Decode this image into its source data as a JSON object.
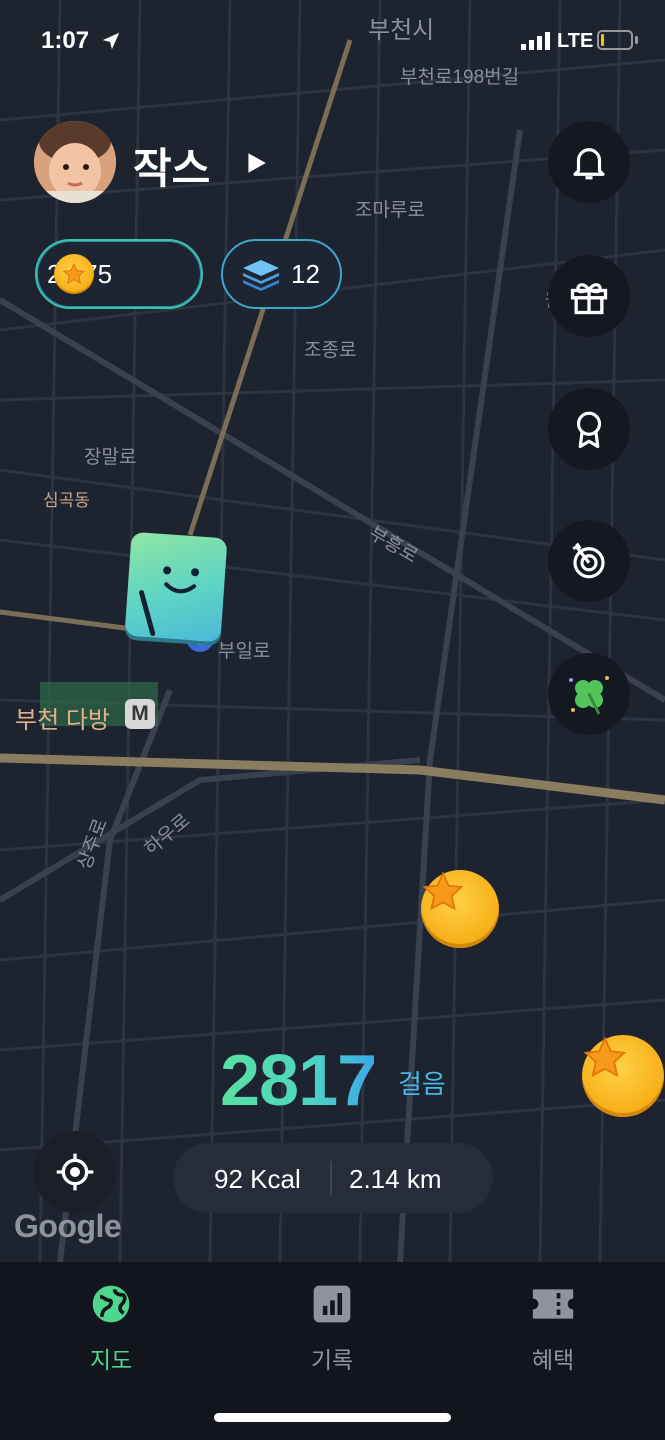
{
  "status_bar": {
    "time": "1:07",
    "network": "LTE"
  },
  "profile": {
    "name": "작스"
  },
  "wallet": {
    "coins": "2,375",
    "layers": "12"
  },
  "map": {
    "labels": {
      "bucheon_si": "부천시",
      "bucheonro": "부천로198번길",
      "jomaruro": "조마루로",
      "jongro": "조종로",
      "jangmalro": "장말로",
      "simgokdong": "심곡동",
      "buheungro": "부흥로",
      "builro": "부일로",
      "station": "부천 다방",
      "metro": "M",
      "haeuro": "하우로",
      "sangjuro": "상주로",
      "won": "원"
    },
    "attribution": "Google"
  },
  "activity": {
    "steps": "2817",
    "steps_unit": "걸음",
    "kcal": "92 Kcal",
    "distance": "2.14 km"
  },
  "tabs": [
    {
      "label": "지도",
      "icon": "globe-icon",
      "active": true
    },
    {
      "label": "기록",
      "icon": "chart-icon",
      "active": false
    },
    {
      "label": "혜택",
      "icon": "ticket-icon",
      "active": false
    }
  ],
  "colors": {
    "accent_green": "#4fd68e",
    "accent_blue": "#3aa8e8",
    "coin_gold": "#f7ae16"
  }
}
